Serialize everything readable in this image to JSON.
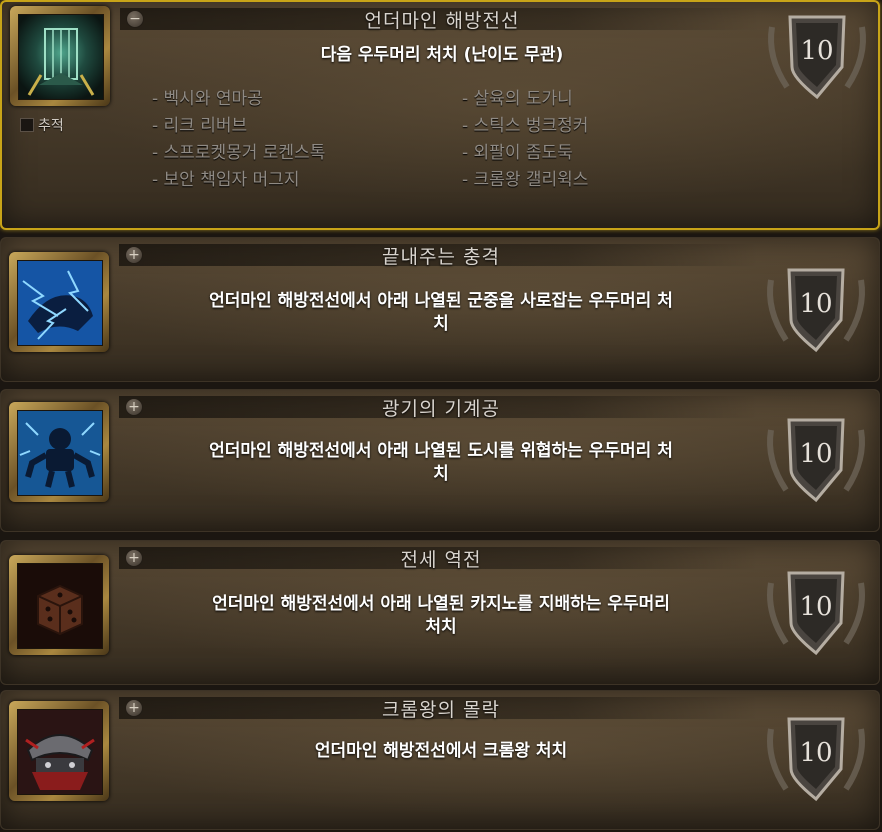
{
  "achievements": [
    {
      "title": "언더마인 해방전선",
      "toggle": "−",
      "description": "다음 우두머리 처치 (난이도 무관)",
      "points": "10",
      "tracking_label": "추적",
      "criteria": [
        "- 벡시와 연마공",
        "- 살육의 도가니",
        "- 리크 리버브",
        "- 스틱스 벙크정커",
        "- 스프로켓몽거 로켄스톡",
        "- 외팔이 좀도둑",
        "- 보안 책임자 머그지",
        "- 크롬왕 갤리윅스"
      ]
    },
    {
      "title": "끝내주는 충격",
      "toggle": "+",
      "description_line1": "언더마인 해방전선에서 아래 나열된 군중을 사로잡는 우두머리 처",
      "description_line2": "치",
      "points": "10"
    },
    {
      "title": "광기의 기계공",
      "toggle": "+",
      "description_line1": "언더마인 해방전선에서 아래 나열된 도시를 위협하는 우두머리 처",
      "description_line2": "치",
      "points": "10"
    },
    {
      "title": "전세 역전",
      "toggle": "+",
      "description_line1": "언더마인 해방전선에서 아래 나열된 카지노를 지배하는 우두머리",
      "description_line2": "처치",
      "points": "10"
    },
    {
      "title": "크롬왕의 몰락",
      "toggle": "+",
      "description": "언더마인 해방전선에서 크롬왕 처치",
      "points": "10"
    }
  ],
  "icons": [
    "undermine-cage-icon",
    "lightning-beast-icon",
    "mechanic-robot-icon",
    "casino-dice-icon",
    "chrome-king-helmet-icon"
  ],
  "colors": {
    "highlight_border": "#c8a418",
    "title_text": "#d9d4ce",
    "criteria_text": "#8f8a84"
  }
}
